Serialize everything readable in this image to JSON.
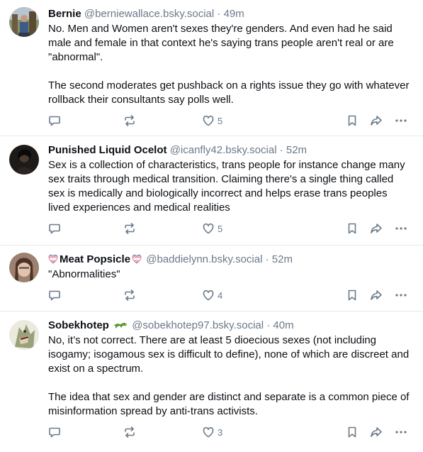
{
  "posts": [
    {
      "name": "Bernie",
      "handle": "@berniewallace.bsky.social",
      "time": "49m",
      "paragraphs": [
        "No. Men and Women aren't sexes they're genders. And even had he said male and female in that context he's saying trans people aren't real or are \"abnormal\".",
        "The second moderates get pushback on a rights issue they go with whatever rollback their consultants say polls well."
      ],
      "likes": "5"
    },
    {
      "name": "Punished Liquid Ocelot",
      "handle": "@icanfly42.bsky.social",
      "time": "52m",
      "paragraphs": [
        "Sex is a collection of characteristics, trans people for instance change many sex traits through medical transition. Claiming there's a single thing called sex is medically and biologically incorrect and helps erase trans peoples lived experiences and medical realities"
      ],
      "likes": "5"
    },
    {
      "name": "Meat Popsicle",
      "handle": "@baddielynn.bsky.social",
      "time": "52m",
      "paragraphs": [
        "\"Abnormalities\""
      ],
      "likes": "4"
    },
    {
      "name": "Sobekhotep",
      "handle": "@sobekhotep97.bsky.social",
      "time": "40m",
      "paragraphs": [
        "No, it’s not correct. There are at least 5 dioecious sexes (not including isogamy; isogamous sex is difficult to define), none of which are discreet and exist on a spectrum.",
        "The idea that sex and gender are distinct and separate is a common piece of misinformation spread by anti-trans activists."
      ],
      "likes": "3"
    }
  ],
  "separator": " · ",
  "icons": {
    "reply": "speech-bubble-icon",
    "repost": "repost-arrows-icon",
    "like": "heart-icon",
    "bookmark": "bookmark-icon",
    "share": "share-arrow-icon",
    "more": "ellipsis-icon",
    "name_badge": "trans-flag-heart-icon",
    "crocodile": "crocodile-icon"
  },
  "colors": {
    "text": "#0b0f14",
    "muted": "#6b7a89",
    "divider": "#e4e8ec",
    "trans_blue": "#5bcefa",
    "trans_pink": "#f5a9b8"
  }
}
